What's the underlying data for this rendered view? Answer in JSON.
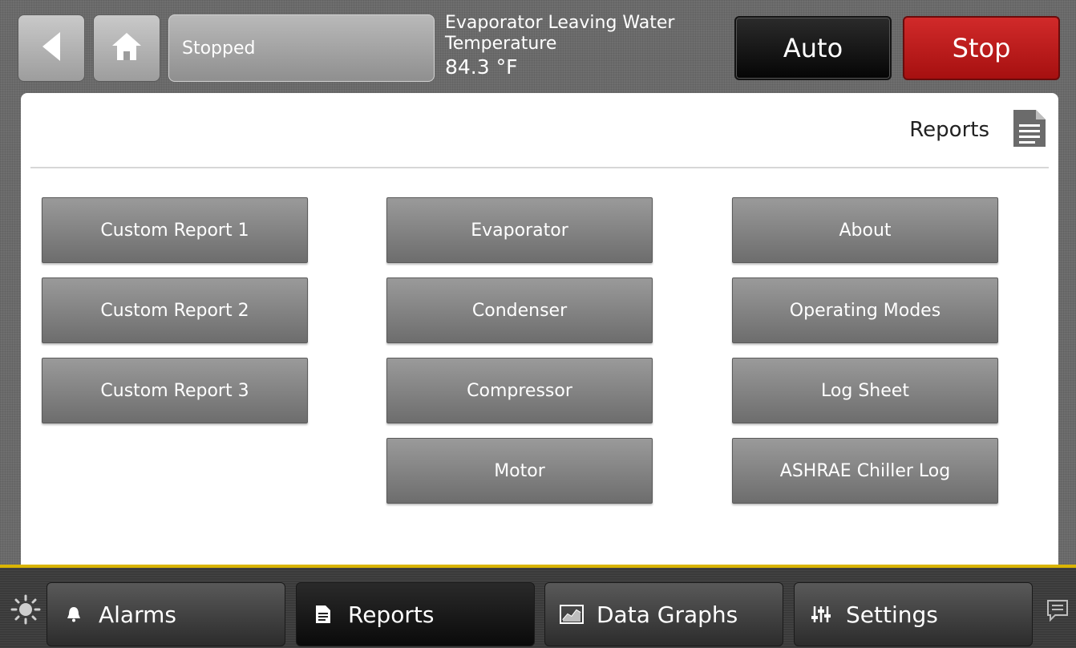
{
  "topbar": {
    "status": "Stopped",
    "temperature_label": "Evaporator Leaving Water Temperature",
    "temperature_value": "84.3 °F",
    "auto_label": "Auto",
    "stop_label": "Stop"
  },
  "page": {
    "title": "Reports"
  },
  "reports": {
    "column1": [
      "Custom Report 1",
      "Custom Report 2",
      "Custom Report 3"
    ],
    "column2": [
      "Evaporator",
      "Condenser",
      "Compressor",
      "Motor"
    ],
    "column3": [
      "About",
      "Operating Modes",
      "Log Sheet",
      "ASHRAE Chiller Log"
    ]
  },
  "tabs": [
    {
      "label": "Alarms",
      "icon": "bell-icon"
    },
    {
      "label": "Reports",
      "icon": "document-icon",
      "active": true
    },
    {
      "label": "Data Graphs",
      "icon": "graph-icon"
    },
    {
      "label": "Settings",
      "icon": "sliders-icon"
    }
  ],
  "colors": {
    "stop": "#c01c1c",
    "accent_bar": "#d9b400"
  }
}
